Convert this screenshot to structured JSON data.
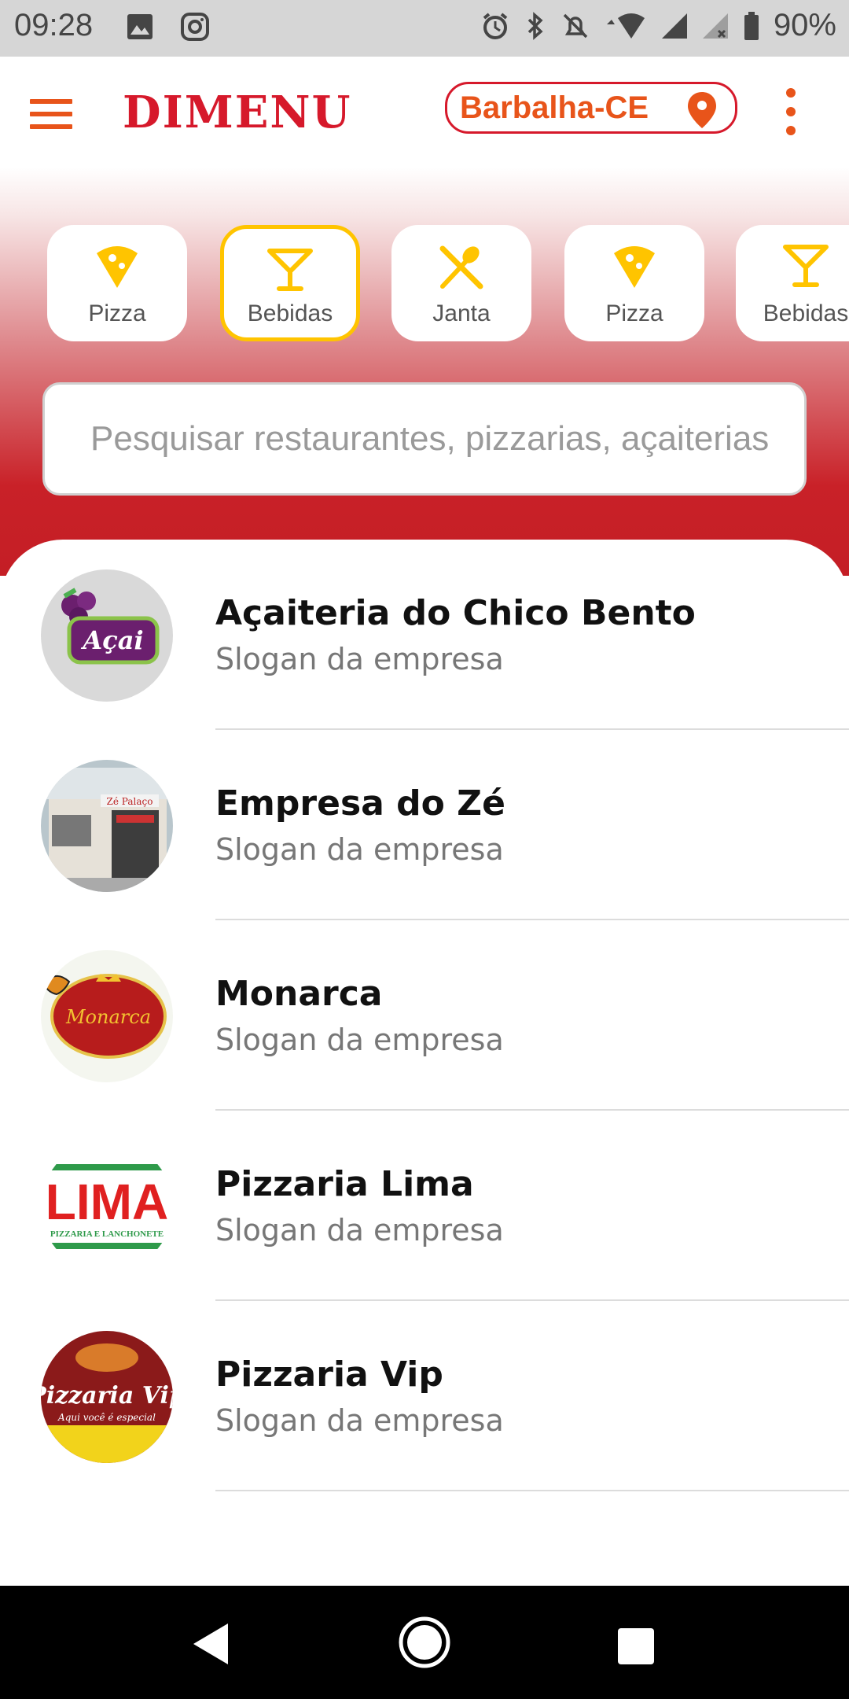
{
  "status_bar": {
    "time": "09:28",
    "battery": "90%"
  },
  "app_bar": {
    "logo": "DIMENU",
    "location": "Barbalha-CE"
  },
  "categories": [
    {
      "label": "Pizza",
      "icon": "pizza-icon",
      "selected": false
    },
    {
      "label": "Bebidas",
      "icon": "cocktail-icon",
      "selected": true
    },
    {
      "label": "Janta",
      "icon": "cutlery-icon",
      "selected": false
    },
    {
      "label": "Pizza",
      "icon": "pizza-icon",
      "selected": false
    },
    {
      "label": "Bebidas",
      "icon": "cocktail-icon",
      "selected": false
    }
  ],
  "search": {
    "placeholder": "Pesquisar restaurantes, pizzarias, açaiterias"
  },
  "restaurants": [
    {
      "name": "Açaiteria do Chico Bento",
      "slogan": "Slogan da empresa",
      "logo_text": "Açai"
    },
    {
      "name": "Empresa do Zé",
      "slogan": "Slogan da empresa",
      "logo_text": "Zé Palaço"
    },
    {
      "name": "Monarca",
      "slogan": "Slogan da empresa",
      "logo_text": "Monarca"
    },
    {
      "name": "Pizzaria Lima",
      "slogan": "Slogan da empresa",
      "logo_text": "LIMA",
      "logo_subtext": "PIZZARIA E LANCHONETE"
    },
    {
      "name": "Pizzaria Vip",
      "slogan": "Slogan da empresa",
      "logo_text": "Pizzaria Vip",
      "logo_subtext": "Aqui você é especial"
    }
  ],
  "colors": {
    "accent": "#e8541a",
    "brand_red": "#d6192b",
    "category_yellow": "#ffc400",
    "hero_red": "#c41e25"
  }
}
